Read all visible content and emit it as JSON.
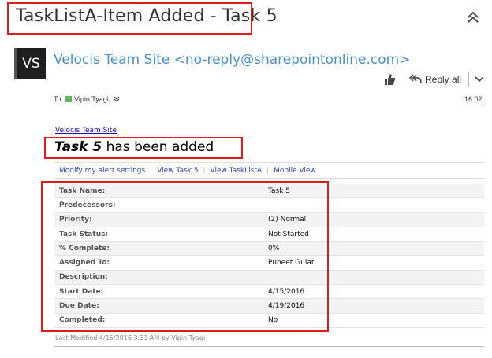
{
  "email": {
    "subject": "TaskListA-Item Added - Task 5",
    "avatar_initials": "VS",
    "sender": "Velocis Team Site <no-reply@sharepointonline.com>",
    "reply_label": "Reply all",
    "to_label": "To:",
    "recipient": "Vipin Tyagi;",
    "time": "16:02"
  },
  "body": {
    "site_link": "Velocis Team Site",
    "headline_item": "Task 5",
    "headline_rest": " has been added",
    "links": [
      "Modify my alert settings",
      "View Task 5",
      "View TaskListA",
      "Mobile View"
    ],
    "fields": [
      {
        "label": "Task Name:",
        "value": "Task 5"
      },
      {
        "label": "Predecessors:",
        "value": ""
      },
      {
        "label": "Priority:",
        "value": "(2) Normal"
      },
      {
        "label": "Task Status:",
        "value": "Not Started"
      },
      {
        "label": "% Complete:",
        "value": "0%"
      },
      {
        "label": "Assigned To:",
        "value": "Puneet Gulati"
      },
      {
        "label": "Description:",
        "value": ""
      },
      {
        "label": "Start Date:",
        "value": "4/15/2016"
      },
      {
        "label": "Due Date:",
        "value": "4/19/2016"
      },
      {
        "label": "Completed:",
        "value": "No"
      }
    ],
    "footer": "Last Modified 4/15/2016 3:31 AM by Vipin Tyagi"
  },
  "colors": {
    "highlight": "#e01b1b",
    "sender_link": "#4a90c8",
    "presence": "#5cb85c"
  },
  "icons": [
    "chevron-up-icon",
    "thumbs-up-icon",
    "reply-all-icon",
    "chevron-down-icon"
  ]
}
